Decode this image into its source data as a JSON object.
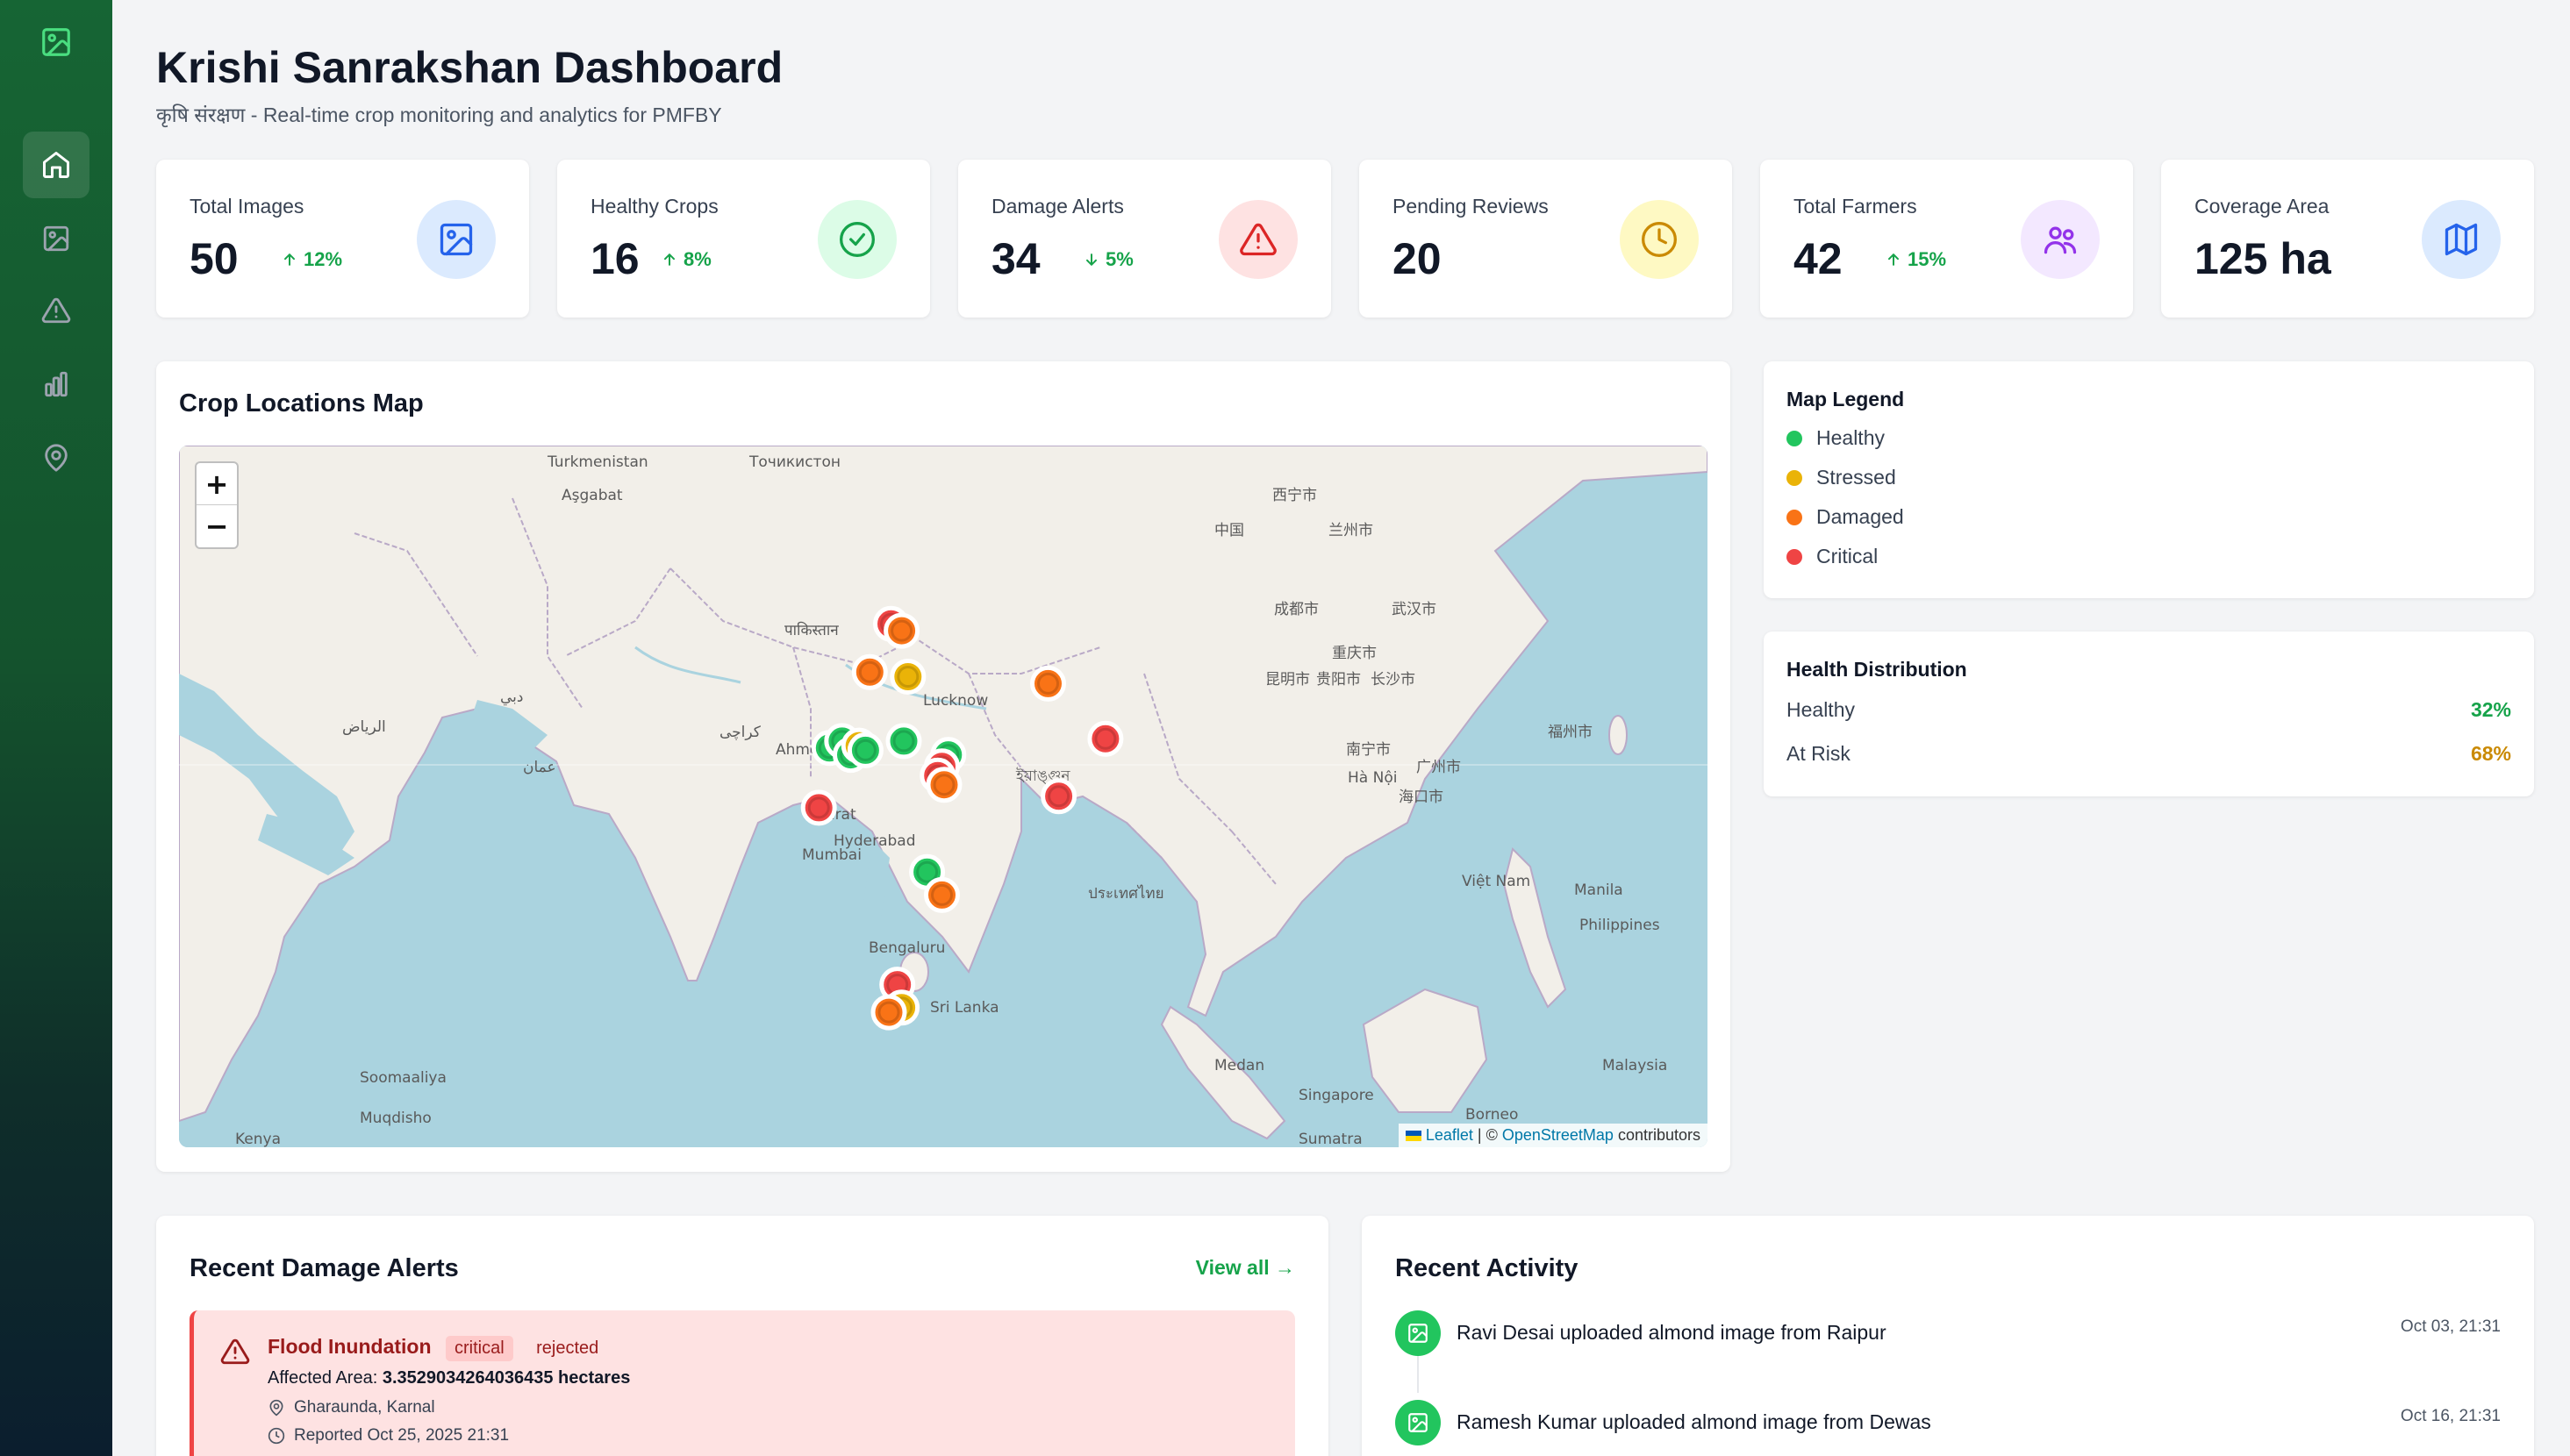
{
  "header": {
    "title": "Krishi Sanrakshan Dashboard",
    "subtitle": "कृषि संरक्षण - Real-time crop monitoring and analytics for PMFBY"
  },
  "sidebar": {
    "logo_icon": "image-icon",
    "items": [
      {
        "icon": "home-icon",
        "active": true
      },
      {
        "icon": "image-icon",
        "active": false
      },
      {
        "icon": "alert-triangle-icon",
        "active": false
      },
      {
        "icon": "bar-chart-icon",
        "active": false
      },
      {
        "icon": "map-pin-icon",
        "active": false
      }
    ]
  },
  "stats": [
    {
      "label": "Total Images",
      "value": "50",
      "trend": "12%",
      "trend_dir": "up",
      "icon": "image-icon",
      "color": "#2563eb",
      "bg": "#dbeafe"
    },
    {
      "label": "Healthy Crops",
      "value": "16",
      "trend": "8%",
      "trend_dir": "up",
      "icon": "check-circle-icon",
      "color": "#16a34a",
      "bg": "#dcfce7"
    },
    {
      "label": "Damage Alerts",
      "value": "34",
      "trend": "5%",
      "trend_dir": "down",
      "icon": "alert-triangle-icon",
      "color": "#dc2626",
      "bg": "#fee2e2"
    },
    {
      "label": "Pending Reviews",
      "value": "20",
      "trend": "",
      "trend_dir": "",
      "icon": "clock-icon",
      "color": "#ca8a04",
      "bg": "#fef9c3"
    },
    {
      "label": "Total Farmers",
      "value": "42",
      "trend": "15%",
      "trend_dir": "up",
      "icon": "users-icon",
      "color": "#9333ea",
      "bg": "#f3e8ff"
    },
    {
      "label": "Coverage Area",
      "value": "125 ha",
      "trend": "",
      "trend_dir": "",
      "icon": "map-icon",
      "color": "#2563eb",
      "bg": "#dbeafe"
    }
  ],
  "map": {
    "title": "Crop Locations Map",
    "zoom_in": "+",
    "zoom_out": "−",
    "attribution": {
      "leaflet": "Leaflet",
      "sep": " | © ",
      "osm": "OpenStreetMap",
      "suffix": " contributors"
    },
    "place_labels": [
      "Turkmenistan",
      "Aşgabat",
      "Точикистон",
      "पाकिस्तान",
      "Lucknow",
      "Ahmedabad",
      "Surat",
      "Mumbai",
      "Hyderabad",
      "Bengaluru",
      "Sri Lanka",
      "中国",
      "西宁市",
      "兰州市",
      "成都市",
      "重庆市",
      "昆明市",
      "贵阳市",
      "长沙市",
      "武汉市",
      "南宁市",
      "广州市",
      "福州市",
      "Hà Nội",
      "海口市",
      "Manila",
      "Philippines",
      "Việt Nam",
      "Medan",
      "Singapore",
      "Malaysia",
      "Borneo",
      "Sumatra",
      "Kenya",
      "Soomaaliya",
      "Muqdisho",
      "الرياض",
      "عمان",
      "دبي",
      "كراچی",
      "ইয়াঙ্গুন",
      "ประเทศไทย"
    ],
    "markers": [
      {
        "status": "critical",
        "lat": 29.0,
        "lon": 76.8
      },
      {
        "status": "damaged",
        "lat": 28.7,
        "lon": 77.3
      },
      {
        "status": "damaged",
        "lat": 26.9,
        "lon": 75.8
      },
      {
        "status": "stressed",
        "lat": 26.7,
        "lon": 77.6
      },
      {
        "status": "damaged",
        "lat": 26.4,
        "lon": 84.2
      },
      {
        "status": "critical",
        "lat": 24.0,
        "lon": 86.9
      },
      {
        "status": "healthy",
        "lat": 23.6,
        "lon": 73.9
      },
      {
        "status": "healthy",
        "lat": 23.9,
        "lon": 74.5
      },
      {
        "status": "healthy",
        "lat": 23.3,
        "lon": 74.9
      },
      {
        "status": "stressed",
        "lat": 23.7,
        "lon": 75.3
      },
      {
        "status": "healthy",
        "lat": 23.5,
        "lon": 75.6
      },
      {
        "status": "healthy",
        "lat": 23.9,
        "lon": 77.4
      },
      {
        "status": "healthy",
        "lat": 23.3,
        "lon": 79.5
      },
      {
        "status": "critical",
        "lat": 22.8,
        "lon": 79.2
      },
      {
        "status": "critical",
        "lat": 22.4,
        "lon": 79.0
      },
      {
        "status": "damaged",
        "lat": 22.0,
        "lon": 79.3
      },
      {
        "status": "critical",
        "lat": 21.5,
        "lon": 84.7
      },
      {
        "status": "critical",
        "lat": 21.0,
        "lon": 73.4
      },
      {
        "status": "healthy",
        "lat": 18.2,
        "lon": 78.5
      },
      {
        "status": "damaged",
        "lat": 17.2,
        "lon": 79.2
      },
      {
        "status": "critical",
        "lat": 13.3,
        "lon": 77.1
      },
      {
        "status": "stressed",
        "lat": 12.3,
        "lon": 77.3
      },
      {
        "status": "damaged",
        "lat": 12.1,
        "lon": 76.7
      }
    ]
  },
  "legend": {
    "title": "Map Legend",
    "items": [
      {
        "label": "Healthy",
        "color": "#22c55e"
      },
      {
        "label": "Stressed",
        "color": "#eab308"
      },
      {
        "label": "Damaged",
        "color": "#f97316"
      },
      {
        "label": "Critical",
        "color": "#ef4444"
      }
    ]
  },
  "distribution": {
    "title": "Health Distribution",
    "rows": [
      {
        "label": "Healthy",
        "value": "32%",
        "color": "#16a34a"
      },
      {
        "label": "At Risk",
        "value": "68%",
        "color": "#ca8a04"
      }
    ]
  },
  "alerts": {
    "title": "Recent Damage Alerts",
    "view_all": "View all →",
    "items": [
      {
        "title": "Flood Inundation",
        "severity": "critical",
        "status": "rejected",
        "area_prefix": "Affected Area: ",
        "area_value": "3.3529034264036435 hectares",
        "location": "Gharaunda, Karnal",
        "reported": "Reported Oct 25, 2025 21:31"
      }
    ]
  },
  "activity": {
    "title": "Recent Activity",
    "items": [
      {
        "text": "Ravi Desai uploaded almond image from Raipur",
        "time": "Oct 03, 21:31",
        "icon": "image-icon"
      },
      {
        "text": "Ramesh Kumar uploaded almond image from Dewas",
        "time": "Oct 16, 21:31",
        "icon": "image-icon"
      }
    ]
  }
}
